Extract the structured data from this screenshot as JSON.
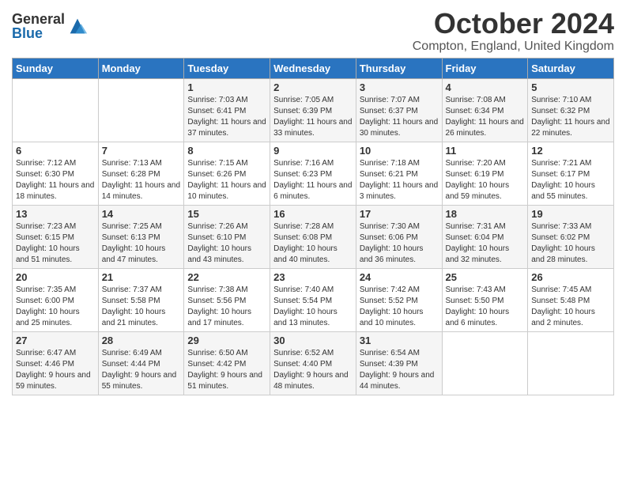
{
  "logo": {
    "general": "General",
    "blue": "Blue"
  },
  "title": "October 2024",
  "location": "Compton, England, United Kingdom",
  "days_of_week": [
    "Sunday",
    "Monday",
    "Tuesday",
    "Wednesday",
    "Thursday",
    "Friday",
    "Saturday"
  ],
  "weeks": [
    [
      {
        "day": "",
        "content": ""
      },
      {
        "day": "",
        "content": ""
      },
      {
        "day": "1",
        "content": "Sunrise: 7:03 AM\nSunset: 6:41 PM\nDaylight: 11 hours and 37 minutes."
      },
      {
        "day": "2",
        "content": "Sunrise: 7:05 AM\nSunset: 6:39 PM\nDaylight: 11 hours and 33 minutes."
      },
      {
        "day": "3",
        "content": "Sunrise: 7:07 AM\nSunset: 6:37 PM\nDaylight: 11 hours and 30 minutes."
      },
      {
        "day": "4",
        "content": "Sunrise: 7:08 AM\nSunset: 6:34 PM\nDaylight: 11 hours and 26 minutes."
      },
      {
        "day": "5",
        "content": "Sunrise: 7:10 AM\nSunset: 6:32 PM\nDaylight: 11 hours and 22 minutes."
      }
    ],
    [
      {
        "day": "6",
        "content": "Sunrise: 7:12 AM\nSunset: 6:30 PM\nDaylight: 11 hours and 18 minutes."
      },
      {
        "day": "7",
        "content": "Sunrise: 7:13 AM\nSunset: 6:28 PM\nDaylight: 11 hours and 14 minutes."
      },
      {
        "day": "8",
        "content": "Sunrise: 7:15 AM\nSunset: 6:26 PM\nDaylight: 11 hours and 10 minutes."
      },
      {
        "day": "9",
        "content": "Sunrise: 7:16 AM\nSunset: 6:23 PM\nDaylight: 11 hours and 6 minutes."
      },
      {
        "day": "10",
        "content": "Sunrise: 7:18 AM\nSunset: 6:21 PM\nDaylight: 11 hours and 3 minutes."
      },
      {
        "day": "11",
        "content": "Sunrise: 7:20 AM\nSunset: 6:19 PM\nDaylight: 10 hours and 59 minutes."
      },
      {
        "day": "12",
        "content": "Sunrise: 7:21 AM\nSunset: 6:17 PM\nDaylight: 10 hours and 55 minutes."
      }
    ],
    [
      {
        "day": "13",
        "content": "Sunrise: 7:23 AM\nSunset: 6:15 PM\nDaylight: 10 hours and 51 minutes."
      },
      {
        "day": "14",
        "content": "Sunrise: 7:25 AM\nSunset: 6:13 PM\nDaylight: 10 hours and 47 minutes."
      },
      {
        "day": "15",
        "content": "Sunrise: 7:26 AM\nSunset: 6:10 PM\nDaylight: 10 hours and 43 minutes."
      },
      {
        "day": "16",
        "content": "Sunrise: 7:28 AM\nSunset: 6:08 PM\nDaylight: 10 hours and 40 minutes."
      },
      {
        "day": "17",
        "content": "Sunrise: 7:30 AM\nSunset: 6:06 PM\nDaylight: 10 hours and 36 minutes."
      },
      {
        "day": "18",
        "content": "Sunrise: 7:31 AM\nSunset: 6:04 PM\nDaylight: 10 hours and 32 minutes."
      },
      {
        "day": "19",
        "content": "Sunrise: 7:33 AM\nSunset: 6:02 PM\nDaylight: 10 hours and 28 minutes."
      }
    ],
    [
      {
        "day": "20",
        "content": "Sunrise: 7:35 AM\nSunset: 6:00 PM\nDaylight: 10 hours and 25 minutes."
      },
      {
        "day": "21",
        "content": "Sunrise: 7:37 AM\nSunset: 5:58 PM\nDaylight: 10 hours and 21 minutes."
      },
      {
        "day": "22",
        "content": "Sunrise: 7:38 AM\nSunset: 5:56 PM\nDaylight: 10 hours and 17 minutes."
      },
      {
        "day": "23",
        "content": "Sunrise: 7:40 AM\nSunset: 5:54 PM\nDaylight: 10 hours and 13 minutes."
      },
      {
        "day": "24",
        "content": "Sunrise: 7:42 AM\nSunset: 5:52 PM\nDaylight: 10 hours and 10 minutes."
      },
      {
        "day": "25",
        "content": "Sunrise: 7:43 AM\nSunset: 5:50 PM\nDaylight: 10 hours and 6 minutes."
      },
      {
        "day": "26",
        "content": "Sunrise: 7:45 AM\nSunset: 5:48 PM\nDaylight: 10 hours and 2 minutes."
      }
    ],
    [
      {
        "day": "27",
        "content": "Sunrise: 6:47 AM\nSunset: 4:46 PM\nDaylight: 9 hours and 59 minutes."
      },
      {
        "day": "28",
        "content": "Sunrise: 6:49 AM\nSunset: 4:44 PM\nDaylight: 9 hours and 55 minutes."
      },
      {
        "day": "29",
        "content": "Sunrise: 6:50 AM\nSunset: 4:42 PM\nDaylight: 9 hours and 51 minutes."
      },
      {
        "day": "30",
        "content": "Sunrise: 6:52 AM\nSunset: 4:40 PM\nDaylight: 9 hours and 48 minutes."
      },
      {
        "day": "31",
        "content": "Sunrise: 6:54 AM\nSunset: 4:39 PM\nDaylight: 9 hours and 44 minutes."
      },
      {
        "day": "",
        "content": ""
      },
      {
        "day": "",
        "content": ""
      }
    ]
  ]
}
